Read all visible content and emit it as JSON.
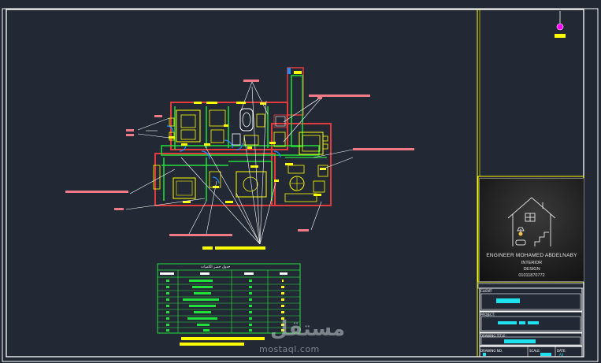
{
  "drawing": {
    "title_block": {
      "logo": {
        "name": "ENGINEER MOHAMED ABDELNABY",
        "line1": "INTERIOR",
        "line2": "DESIGN",
        "phone": "01011870772"
      },
      "client_label": "CLIENT:",
      "project_label": "PROJECT:",
      "drawing_title_label": "DRAWING TITLE:",
      "drawing_no_label": "DRAWING NO.",
      "scale_label": "SCALE:",
      "date_label": "DATE:",
      "sheet_size": "A3"
    },
    "schedule_table": {
      "title": "جدول حصر الكميات",
      "rows": 9
    },
    "colors": {
      "background": "#222834",
      "wall_red": "#e23b3b",
      "green": "#22e03a",
      "yellow": "#ffff00",
      "cyan": "#1fe2ee",
      "label_pink": "#f07a86",
      "blue": "#1f8cff",
      "magenta": "#ff00ff"
    },
    "icons": {
      "north_arrow": "north-arrow-icon",
      "house_logo": "house-logo-icon"
    }
  },
  "watermark": {
    "arabic": "مستقل",
    "latin": "mostaql.com"
  }
}
